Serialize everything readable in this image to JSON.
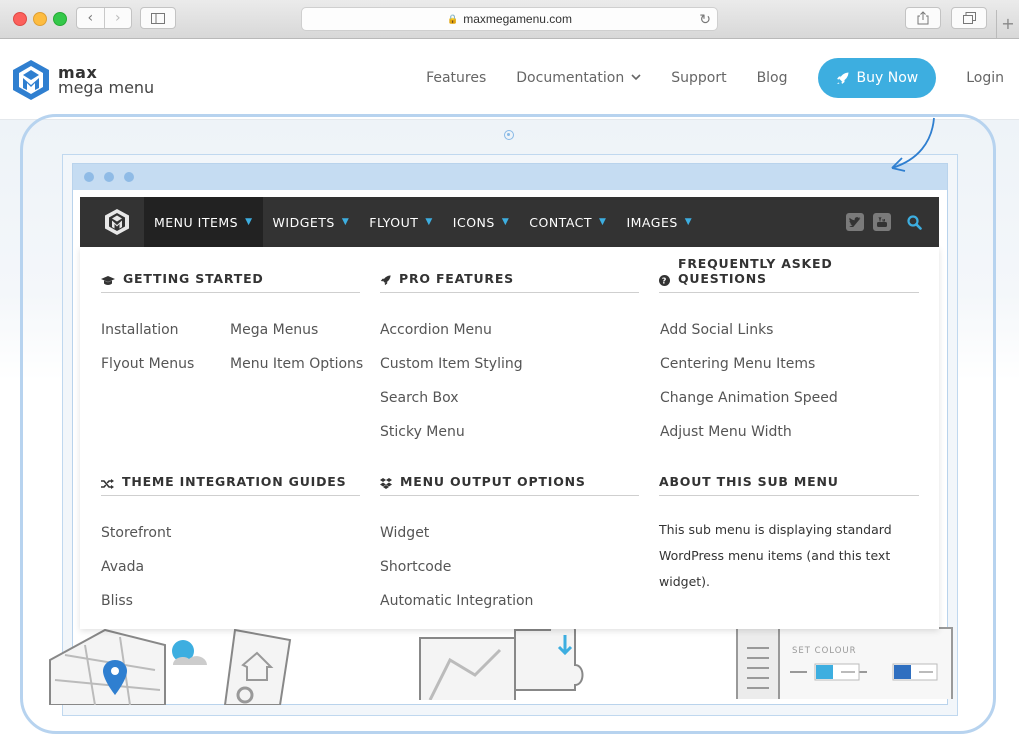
{
  "browser": {
    "url": "maxmegamenu.com"
  },
  "site": {
    "logo_word1": "max",
    "logo_word2": "mega menu",
    "nav": [
      {
        "label": "Features"
      },
      {
        "label": "Documentation"
      },
      {
        "label": "Support"
      },
      {
        "label": "Blog"
      }
    ],
    "buy_label": "Buy Now",
    "login_label": "Login"
  },
  "menu": {
    "items": [
      {
        "label": "MENU ITEMS"
      },
      {
        "label": "WIDGETS"
      },
      {
        "label": "FLYOUT"
      },
      {
        "label": "ICONS"
      },
      {
        "label": "CONTACT"
      },
      {
        "label": "IMAGES"
      }
    ]
  },
  "panel": {
    "getting_started": {
      "title": "GETTING STARTED",
      "links": [
        "Installation",
        "Mega Menus",
        "Flyout Menus",
        "Menu Item Options"
      ]
    },
    "pro_features": {
      "title": "PRO FEATURES",
      "links": [
        "Accordion Menu",
        "Custom Item Styling",
        "Search Box",
        "Sticky Menu"
      ]
    },
    "faq": {
      "title": "FREQUENTLY ASKED QUESTIONS",
      "links": [
        "Add Social Links",
        "Centering Menu Items",
        "Change Animation Speed",
        "Adjust Menu Width"
      ]
    },
    "theme_guides": {
      "title": "THEME INTEGRATION GUIDES",
      "links": [
        "Storefront",
        "Avada",
        "Bliss"
      ]
    },
    "output_options": {
      "title": "MENU OUTPUT OPTIONS",
      "links": [
        "Widget",
        "Shortcode",
        "Automatic Integration"
      ]
    },
    "about": {
      "title": "ABOUT THIS SUB MENU",
      "text": "This sub menu is displaying standard WordPress menu items (and this text widget)."
    }
  },
  "illustration": {
    "set_colour": "SET COLOUR"
  },
  "colors": {
    "accent": "#3daee0",
    "menubar": "#333333",
    "menubar_active": "#222222",
    "frame": "#b7d3ef"
  }
}
